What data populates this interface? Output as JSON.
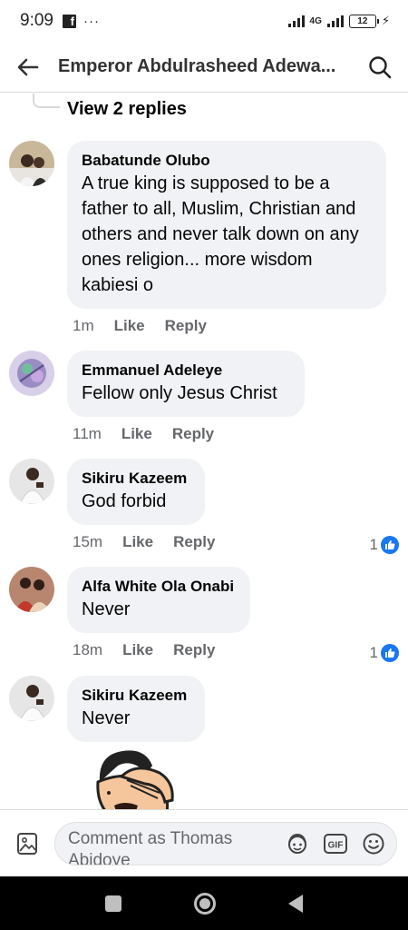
{
  "status_bar": {
    "time": "9:09",
    "dots": "···",
    "network": "4G",
    "battery": "12"
  },
  "header": {
    "title": "Emperor Abdulrasheed Adewa..."
  },
  "thread": {
    "view_replies_label": "View 2 replies"
  },
  "comments": [
    {
      "author": "Babatunde Olubo",
      "text": "A true king is supposed to be a father to all, Muslim, Christian and others and never talk down on any ones religion... more wisdom kabiesi o",
      "time": "1m",
      "like_label": "Like",
      "reply_label": "Reply",
      "reactions": ""
    },
    {
      "author": "Emmanuel Adeleye",
      "text": "Fellow only Jesus Christ",
      "time": "11m",
      "like_label": "Like",
      "reply_label": "Reply",
      "reactions": ""
    },
    {
      "author": "Sikiru Kazeem",
      "text": "God forbid",
      "time": "15m",
      "like_label": "Like",
      "reply_label": "Reply",
      "reactions": "1"
    },
    {
      "author": "Alfa White Ola Onabi",
      "text": "Never",
      "time": "18m",
      "like_label": "Like",
      "reply_label": "Reply",
      "reactions": "1"
    },
    {
      "author": "Sikiru Kazeem",
      "text": "Never"
    }
  ],
  "composer": {
    "placeholder": "Comment as Thomas Abidoye"
  },
  "colors": {
    "bubble": "#f0f2f5",
    "meta_text": "#65676b",
    "like_blue": "#1877f2",
    "nav_bar": "#000000"
  },
  "icons": [
    "back-arrow-icon",
    "search-icon",
    "photo-icon",
    "avatar-sticker-icon",
    "gif-icon",
    "emoji-icon",
    "like-thumb-icon"
  ]
}
